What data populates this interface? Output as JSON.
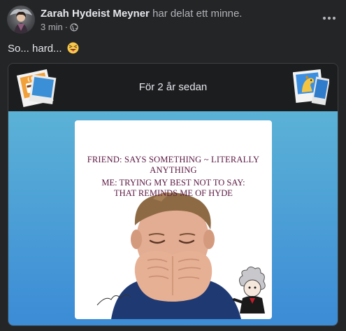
{
  "post": {
    "author": "Zarah Hydeist Meyner",
    "action": "har delat ett minne.",
    "time": "3 min",
    "separator": "·",
    "audience_icon": "globe-icon",
    "text": "So... hard...",
    "emoji": "squinting-tongue-emoji",
    "more_icon": "more-options-icon"
  },
  "memory": {
    "title": "För 2 år sedan",
    "left_decoration": "polaroid-coffee-icon",
    "right_decoration": "polaroid-dog-icon",
    "background_gradient": [
      "#5bb2d6",
      "#3b8bd6"
    ],
    "meme": {
      "line1": "FRIEND: SAYS SOMETHING ~ LITERALLY ANYTHING",
      "line2": "ME: TRYING MY BEST NOT TO SAY:\nTHAT REMINDS ME OF HYDE",
      "text_color": "#5b1842"
    }
  },
  "colors": {
    "background": "#242526",
    "primary_text": "#e4e6eb",
    "secondary_text": "#b0b3b8"
  }
}
